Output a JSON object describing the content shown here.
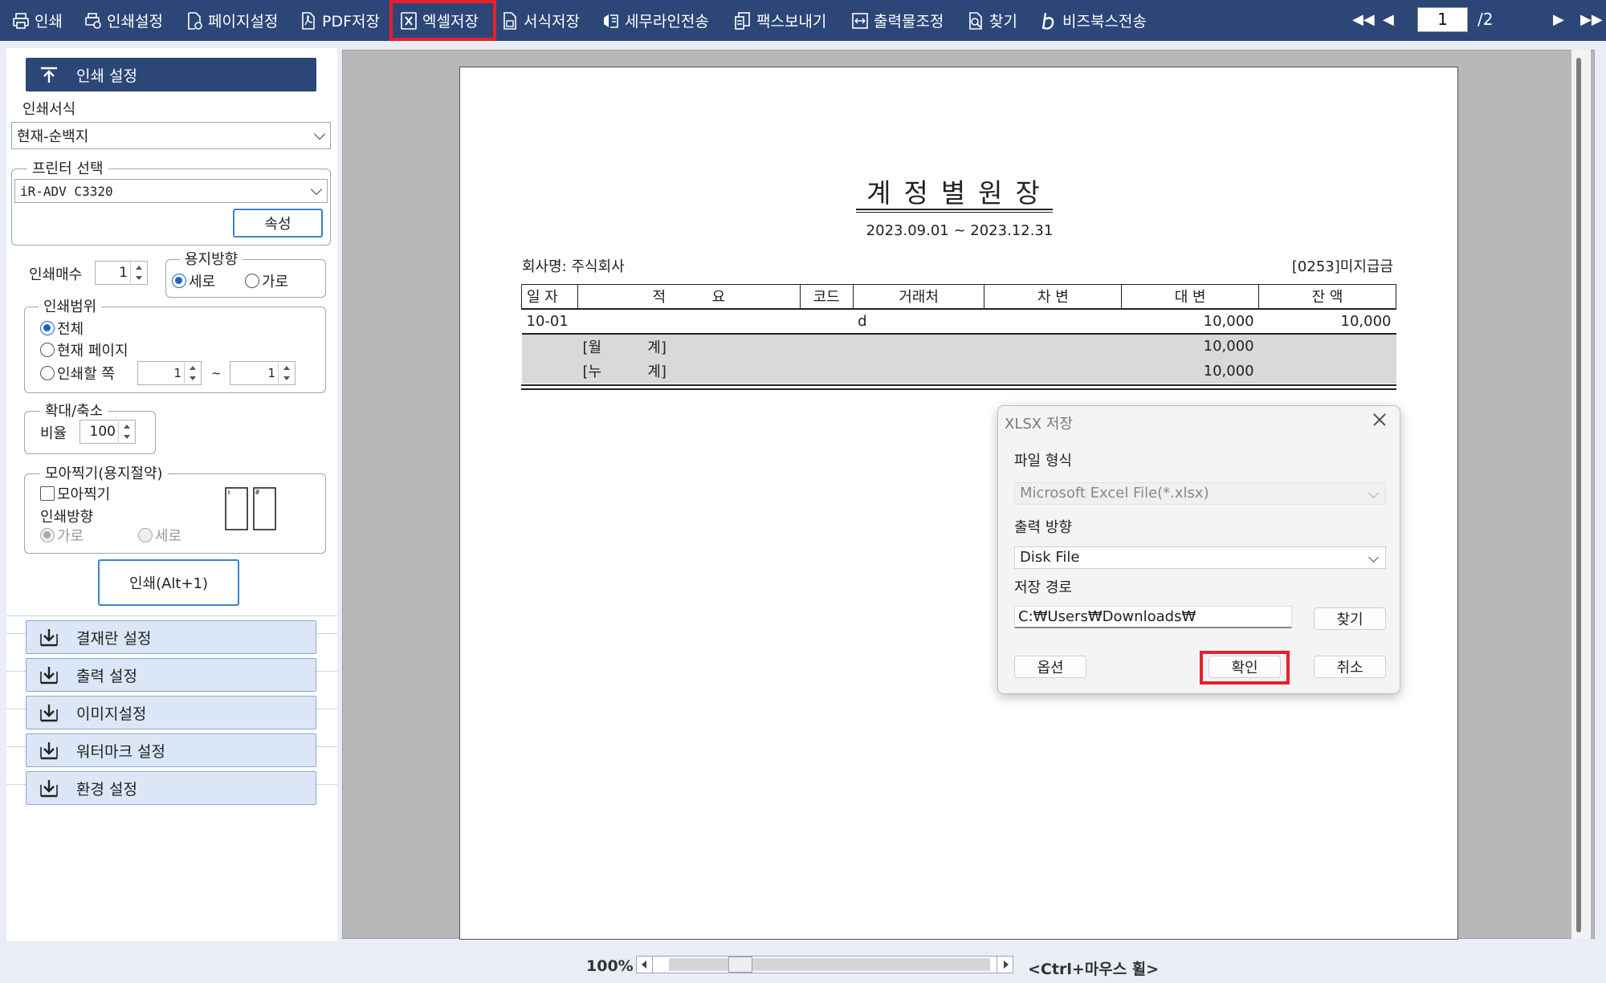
{
  "toolbar": {
    "buttons": [
      {
        "label": "인쇄",
        "icon": "printer-icon"
      },
      {
        "label": "인쇄설정",
        "icon": "printer-settings-icon"
      },
      {
        "label": "페이지설정",
        "icon": "page-settings-icon"
      },
      {
        "label": "PDF저장",
        "icon": "pdf-icon"
      },
      {
        "label": "엑셀저장",
        "icon": "excel-icon"
      },
      {
        "label": "서식저장",
        "icon": "form-save-icon"
      },
      {
        "label": "세무라인전송",
        "icon": "tax-send-icon"
      },
      {
        "label": "팩스보내기",
        "icon": "fax-icon"
      },
      {
        "label": "출력물조정",
        "icon": "output-adjust-icon"
      },
      {
        "label": "찾기",
        "icon": "find-icon"
      },
      {
        "label": "비즈북스전송",
        "icon": "bizbooks-icon"
      }
    ],
    "highlighted": "엑셀저장",
    "page_current": "1",
    "page_total": "/2"
  },
  "sidebar": {
    "print_settings_header": "인쇄 설정",
    "print_form_label": "인쇄서식",
    "print_form_value": "현재-순백지",
    "printer_group_title": "프린터 선택",
    "printer_value": "iR-ADV C3320",
    "properties_button": "속성",
    "copies_label": "인쇄매수",
    "copies_value": "1",
    "orientation_title": "용지방향",
    "orientation_portrait": "세로",
    "orientation_landscape": "가로",
    "range_title": "인쇄범위",
    "range_all": "전체",
    "range_current": "현재 페이지",
    "range_pages": "인쇄할 쪽",
    "range_from": "1",
    "range_tilde": "~",
    "range_to": "1",
    "zoom_title": "확대/축소",
    "zoom_ratio_label": "비율",
    "zoom_ratio_value": "100",
    "nup_title": "모아찍기(용지절약)",
    "nup_checkbox": "모아찍기",
    "nup_orientation_label": "인쇄방향",
    "nup_landscape": "가로",
    "nup_portrait": "세로",
    "print_button": "인쇄(Alt+1)",
    "collapsed_headers": [
      "결재란 설정",
      "출력 설정",
      "이미지설정",
      "워터마크 설정",
      "환경 설정"
    ]
  },
  "document": {
    "title": "계정별원장",
    "period": "2023.09.01 ~ 2023.12.31",
    "company": "회사명: 주식회사",
    "account": "[0253]미지급금",
    "columns": [
      "일 자",
      "적          요",
      "코드",
      "거래처",
      "차 변",
      "대 변",
      "잔 액"
    ],
    "rows": [
      {
        "date": "10-01",
        "summary": "",
        "code": "",
        "partner": "d",
        "debit": "",
        "credit": "10,000",
        "balance": "10,000"
      },
      {
        "date": "",
        "summary": "[월          계]",
        "code": "",
        "partner": "",
        "debit": "",
        "credit": "10,000",
        "balance": ""
      },
      {
        "date": "",
        "summary": "[누          계]",
        "code": "",
        "partner": "",
        "debit": "",
        "credit": "10,000",
        "balance": ""
      }
    ]
  },
  "dialog": {
    "title": "XLSX 저장",
    "file_format_label": "파일 형식",
    "file_format_value": "Microsoft Excel File(*.xlsx)",
    "output_direction_label": "출력 방향",
    "output_direction_value": "Disk File",
    "save_path_label": "저장 경로",
    "save_path_value": "C:₩Users₩Downloads₩",
    "browse_button": "찾기",
    "options_button": "옵션",
    "ok_button": "확인",
    "cancel_button": "취소"
  },
  "statusbar": {
    "zoom": "100%",
    "hint": "<Ctrl+마우스 휠>"
  },
  "colors": {
    "toolbar_bg": "#2c4677",
    "highlight_red": "#e8202a",
    "panel_header_active": "#2c4677",
    "panel_header_collapsed": "#dbe7f7"
  }
}
